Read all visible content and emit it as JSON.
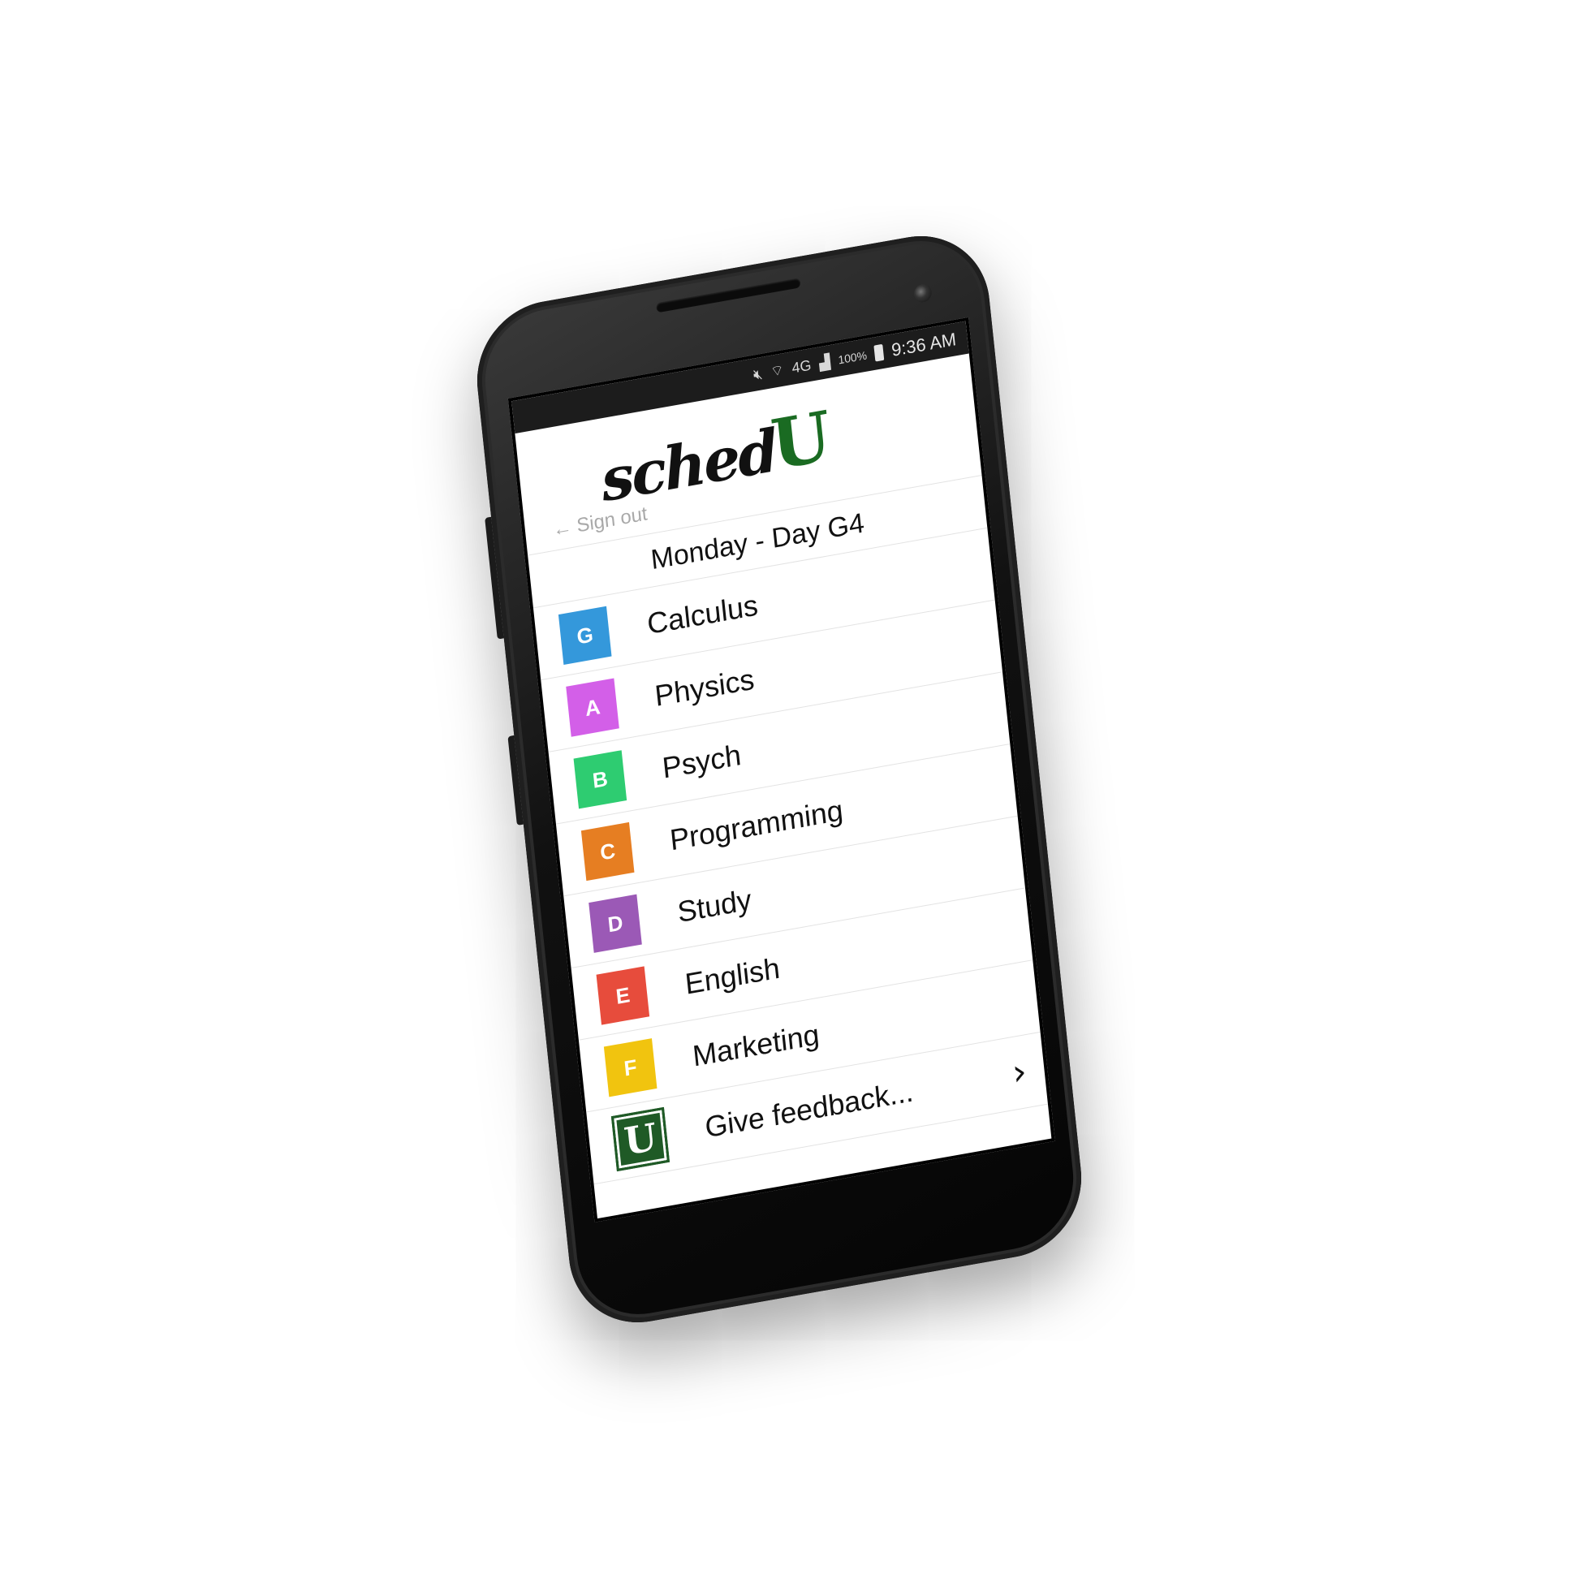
{
  "status_bar": {
    "icons": [
      "mute-icon",
      "wifi-icon",
      "network-4g-icon",
      "signal-icon"
    ],
    "battery_text": "100%",
    "time": "9:36 AM"
  },
  "header": {
    "logo_text": "sched",
    "logo_u": "U",
    "signout_arrow": "←",
    "signout_label": "Sign out"
  },
  "schedule": {
    "day_title": "Monday - Day G4",
    "items": [
      {
        "letter": "G",
        "label": "Calculus",
        "color": "#3498db"
      },
      {
        "letter": "A",
        "label": "Physics",
        "color": "#d35fe8"
      },
      {
        "letter": "B",
        "label": "Psych",
        "color": "#2ecc71"
      },
      {
        "letter": "C",
        "label": "Programming",
        "color": "#e67e22"
      },
      {
        "letter": "D",
        "label": "Study",
        "color": "#9b59b6"
      },
      {
        "letter": "E",
        "label": "English",
        "color": "#e74c3c"
      },
      {
        "letter": "F",
        "label": "Marketing",
        "color": "#f1c40f"
      }
    ]
  },
  "feedback": {
    "badge_letter": "U",
    "label": "Give feedback...",
    "chevron": "›",
    "color": "#1f5a26"
  }
}
